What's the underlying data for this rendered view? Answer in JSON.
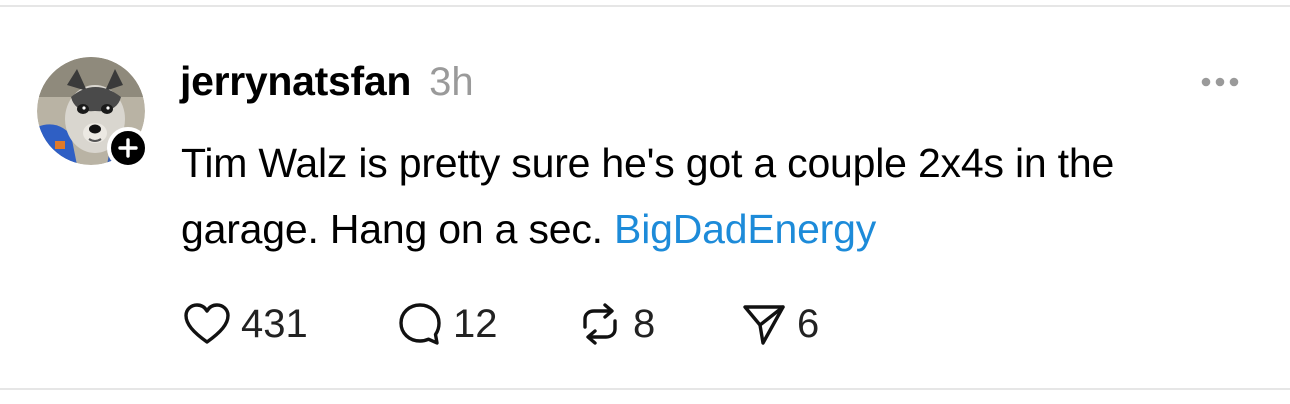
{
  "post": {
    "username": "jerrynatsfan",
    "timestamp": "3h",
    "text": "Tim Walz is pretty sure he's got a couple 2x4s in the garage. Hang on a sec.",
    "hashtag": "BigDadEnergy",
    "avatar_icon": "dog-avatar",
    "follow_icon": "plus-icon",
    "more_icon": "more-horizontal-icon"
  },
  "actions": {
    "likes": "431",
    "replies": "12",
    "reposts": "8",
    "shares": "6"
  },
  "colors": {
    "hashtag": "#1d8bd9",
    "timestamp": "#9a9a9a",
    "text": "#000000",
    "divider": "#e6e6e6"
  }
}
